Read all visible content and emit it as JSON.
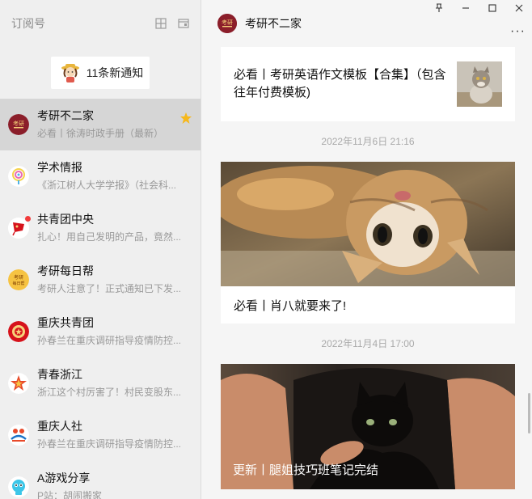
{
  "sidebar": {
    "title": "订阅号",
    "tools": [
      {
        "icon": "grid-icon"
      },
      {
        "icon": "window-icon"
      }
    ],
    "notice": {
      "text": "11条新通知",
      "icon": "girl-avatar-icon"
    },
    "accounts": [
      {
        "name": "考研不二家",
        "desc": "必看丨徐涛时政手册（最新）",
        "active": true,
        "starred": true,
        "icon": "kaoyan-buerjia-logo-icon",
        "color": "#8b1e2a"
      },
      {
        "name": "学术情报",
        "desc": "《浙江树人大学学报》（社会科...",
        "active": false,
        "icon": "xueshu-qingbao-logo-icon",
        "color": "#f5d24a"
      },
      {
        "name": "共青团中央",
        "desc": "扎心！用自己发明的产品，竟然...",
        "active": false,
        "unread": true,
        "icon": "gongqingtuan-logo-icon",
        "color": "#d6121b"
      },
      {
        "name": "考研每日帮",
        "desc": "考研人注意了！正式通知已下发...",
        "active": false,
        "icon": "kaoyan-meiribang-logo-icon",
        "color": "#f6c342"
      },
      {
        "name": "重庆共青团",
        "desc": "孙春兰在重庆调研指导疫情防控...",
        "active": false,
        "icon": "chongqing-gongqingtuan-logo-icon",
        "color": "#d6121b"
      },
      {
        "name": "青春浙江",
        "desc": "浙江这个村厉害了！村民变股东...",
        "active": false,
        "icon": "qingchun-zhejiang-logo-icon",
        "color": "#ffffff"
      },
      {
        "name": "重庆人社",
        "desc": "孙春兰在重庆调研指导疫情防控...",
        "active": false,
        "icon": "chongqing-renshe-logo-icon",
        "color": "#ffffff"
      },
      {
        "name": "A游戏分享",
        "desc": "P站：胡闹搬家",
        "active": false,
        "icon": "a-game-share-logo-icon",
        "color": "#3cc6e8"
      }
    ]
  },
  "main": {
    "title": "考研不二家",
    "window_buttons": [
      {
        "icon": "pin-icon",
        "glyph": "⊥"
      },
      {
        "icon": "minimize-icon",
        "glyph": "—"
      },
      {
        "icon": "maximize-icon",
        "glyph": "☐"
      },
      {
        "icon": "close-icon",
        "glyph": "✕"
      }
    ],
    "more": "···",
    "articles": [
      {
        "title": "必看丨考研英语作文模板【合集】（包含往年付费模板)",
        "thumb": "cat-thumbnail"
      },
      {
        "timestamp": "2022年11月6日  21:16",
        "caption": "必看丨肖八就要来了!",
        "image": "cat-lying-image"
      },
      {
        "timestamp": "2022年11月4日  17:00",
        "caption": "更新丨腿姐技巧班笔记完结",
        "image": "black-cat-image"
      }
    ]
  }
}
